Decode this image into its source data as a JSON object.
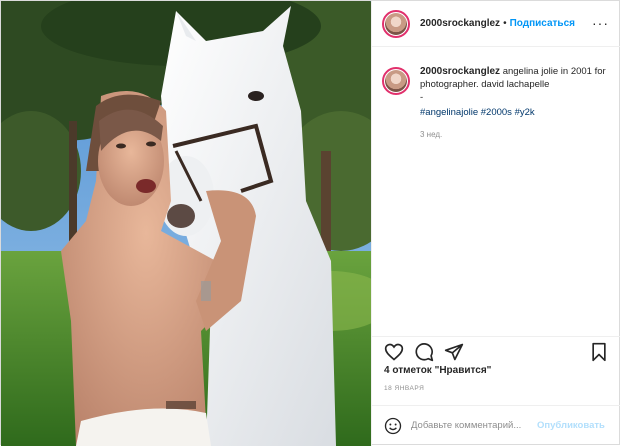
{
  "post": {
    "username": "2000srockanglez",
    "follow_separator": "•",
    "follow_label": "Подписаться",
    "more_label": "···",
    "caption": {
      "username": "2000srockanglez",
      "text": "angelina jolie in 2001 for photographer. david lachapelle",
      "dash": "-",
      "hashtags": [
        "#angelinajolie",
        "#2000s",
        "#y2k"
      ]
    },
    "time_ago": "3 нед.",
    "likes": "4 отметок \"Нравится\"",
    "date": "18 ЯНВАРЯ",
    "comment": {
      "placeholder": "Добавьте комментарий...",
      "publish_label": "Опубликовать"
    },
    "icons": {
      "like": "heart-icon",
      "comment": "comment-icon",
      "share": "share-icon",
      "save": "bookmark-icon",
      "emoji": "smiley-icon"
    },
    "colors": {
      "follow": "#0095f6",
      "hashtag": "#00376b",
      "muted": "#8e8e8e",
      "publish_disabled": "#b2dffc"
    }
  }
}
